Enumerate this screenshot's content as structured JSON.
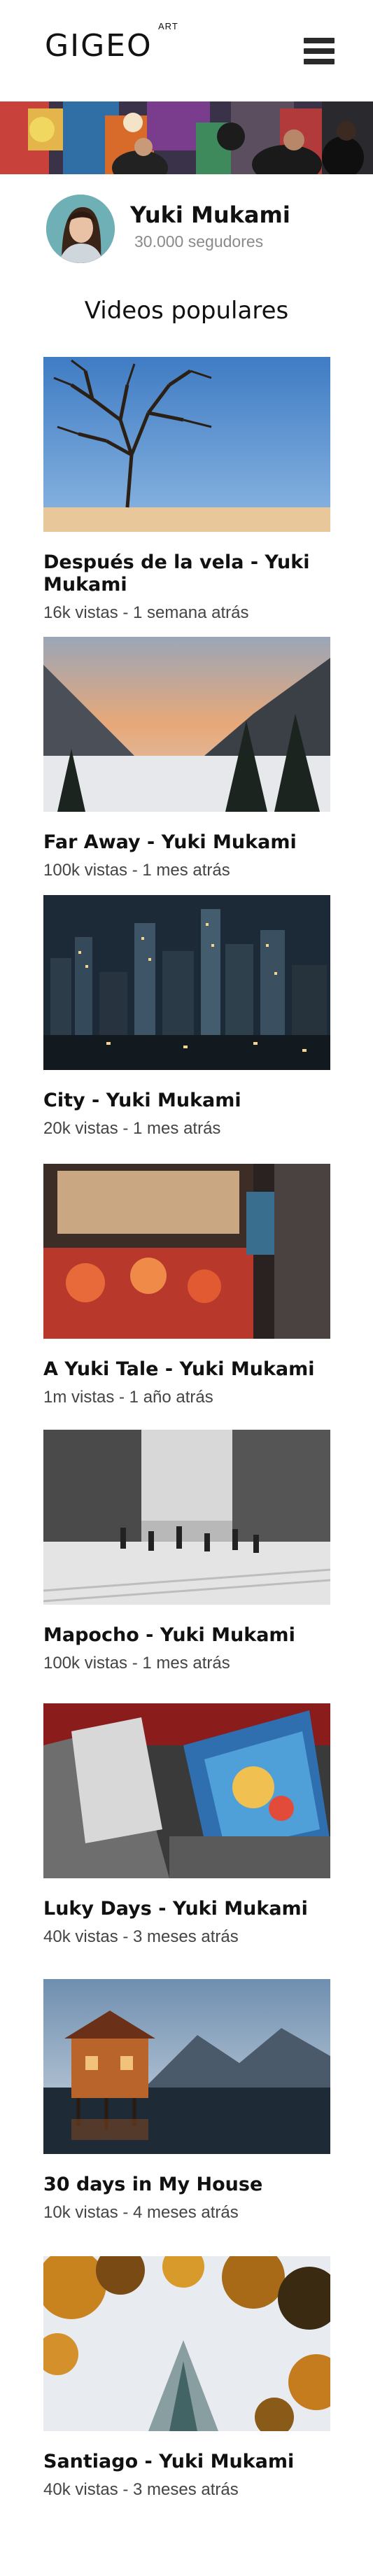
{
  "header": {
    "logo": "GIGEO",
    "logo_sub": "ART",
    "menu_icon": "hamburger-menu-icon"
  },
  "profile": {
    "name": "Yuki Mukami",
    "followers": "30.000 segudores"
  },
  "section_title": "Videos populares",
  "videos": [
    {
      "title": "Después de la vela - Yuki Mukami",
      "meta": "16k vistas - 1 semana atrás"
    },
    {
      "title": "Far Away - Yuki Mukami",
      "meta": "100k vistas - 1 mes atrás"
    },
    {
      "title": "City - Yuki Mukami",
      "meta": "20k vistas - 1 mes atrás"
    },
    {
      "title": "A Yuki Tale - Yuki Mukami",
      "meta": "1m vistas - 1 año atrás"
    },
    {
      "title": "Mapocho - Yuki Mukami",
      "meta": "100k vistas - 1 mes atrás"
    },
    {
      "title": "Luky Days - Yuki Mukami",
      "meta": "40k vistas - 3 meses atrás"
    },
    {
      "title": "30 days in My House",
      "meta": "10k vistas - 4 meses atrás"
    },
    {
      "title": "Santiago - Yuki Mukami",
      "meta": "40k vistas - 3 meses atrás"
    }
  ]
}
